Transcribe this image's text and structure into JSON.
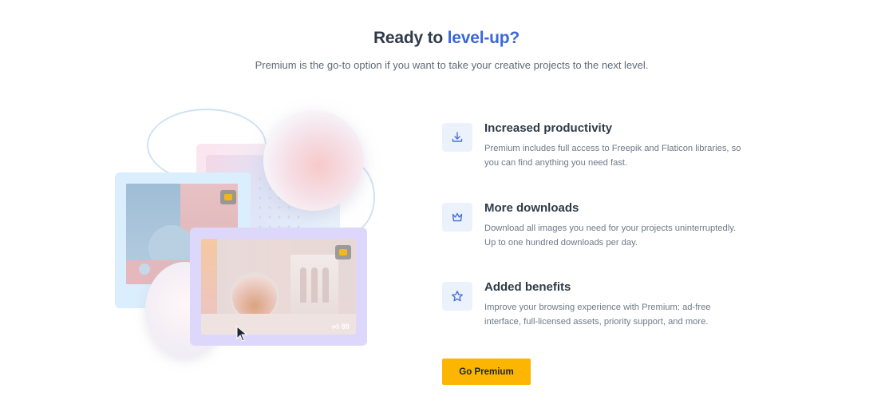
{
  "header": {
    "title_lead": "Ready to",
    "title_accent": "level-up?",
    "subtitle": "Premium is the go-to option if you want to take your creative projects to the next level."
  },
  "illustration": {
    "likes_count": "89"
  },
  "features": [
    {
      "icon": "download-icon",
      "title": "Increased productivity",
      "description": "Premium includes full access to Freepik and Flaticon libraries, so you can find anything you need fast."
    },
    {
      "icon": "crown-icon",
      "title": "More downloads",
      "description": "Download all images you need for your projects uninterruptedly. Up to one hundred downloads per day."
    },
    {
      "icon": "star-icon",
      "title": "Added benefits",
      "description": "Improve your browsing experience with Premium: ad-free interface, full-licensed assets, priority support, and more."
    }
  ],
  "cta": {
    "label": "Go Premium"
  },
  "colors": {
    "accent": "#3b67d9",
    "cta": "#fcb500",
    "icon": "#4a73d6"
  }
}
